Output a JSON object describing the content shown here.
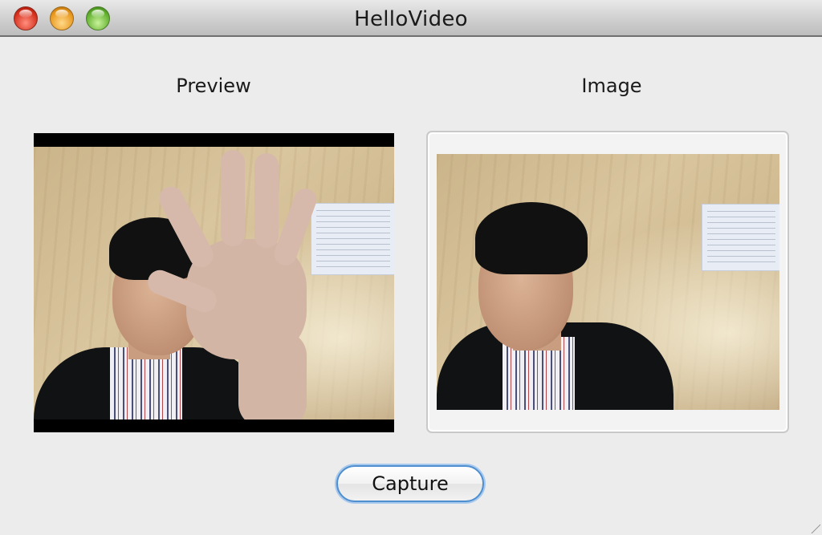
{
  "window": {
    "title": "HelloVideo",
    "buttons": [
      "close",
      "minimize",
      "zoom"
    ]
  },
  "panels": {
    "preview_label": "Preview",
    "image_label": "Image"
  },
  "actions": {
    "capture_label": "Capture"
  },
  "colors": {
    "window_background": "#ececec",
    "button_focus": "#4f8fd0",
    "close": "#d42d1a",
    "minimize": "#e8961a",
    "zoom": "#5fae2c"
  }
}
